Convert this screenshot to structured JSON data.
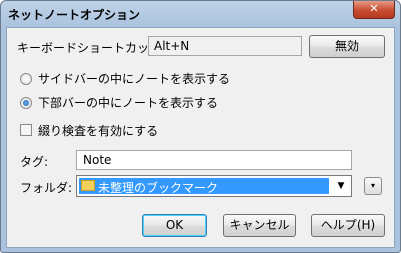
{
  "window": {
    "title": "ネットノートオプション",
    "close_glyph": "✕"
  },
  "shortcut": {
    "label": "キーボードショートカット",
    "value": "Alt+N",
    "disable_button": "無効"
  },
  "display_options": [
    {
      "label": "サイドバーの中にノートを表示する",
      "selected": false
    },
    {
      "label": "下部バーの中にノートを表示する",
      "selected": true
    }
  ],
  "spellcheck": {
    "label": "綴り検査を有効にする",
    "checked": false
  },
  "tag": {
    "label": "タグ:",
    "value": "Note"
  },
  "folder": {
    "label": "フォルダ:",
    "value": "未整理のブックマーク",
    "icon": "folder-icon",
    "dropdown_icon": "chevron-down-icon",
    "expand_icon": "chevron-down-icon"
  },
  "buttons": {
    "ok": "OK",
    "cancel": "キャンセル",
    "help": "ヘルプ",
    "help_accel": "(H)"
  }
}
